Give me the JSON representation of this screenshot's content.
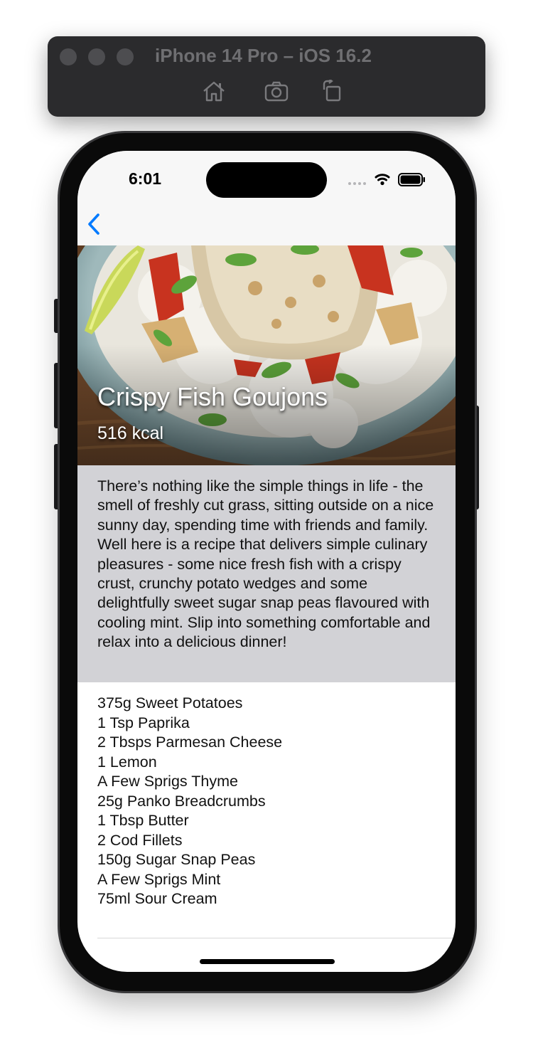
{
  "window": {
    "title": "iPhone 14 Pro – iOS 16.2",
    "toolbar_icons": [
      "home-icon",
      "screenshot-camera-icon",
      "rotate-icon"
    ]
  },
  "status_bar": {
    "time": "6:01",
    "icons": [
      "cellular-dots-icon",
      "wifi-icon",
      "battery-icon"
    ]
  },
  "nav": {
    "back_icon": "chevron-left-icon",
    "accent_color": "#007aff"
  },
  "recipe": {
    "title": "Crispy Fish Goujons",
    "calories": "516 kcal",
    "description": "There’s nothing like the simple things in life - the smell of freshly cut grass, sitting outside on a nice sunny day, spending time with friends and family. Well here is a recipe that delivers simple culinary pleasures - some nice fresh fish with a crispy crust, crunchy potato wedges and some delightfully sweet sugar snap peas flavoured with cooling mint. Slip into something comfortable and relax into a delicious dinner!",
    "ingredients": [
      "375g Sweet Potatoes",
      "1 Tsp Paprika",
      "2 Tbsps Parmesan Cheese",
      "1 Lemon",
      "A Few Sprigs Thyme",
      "25g Panko Breadcrumbs",
      "1 Tbsp Butter",
      "2 Cod Fillets",
      "150g Sugar Snap Peas",
      "A Few Sprigs Mint",
      "75ml Sour Cream"
    ]
  }
}
